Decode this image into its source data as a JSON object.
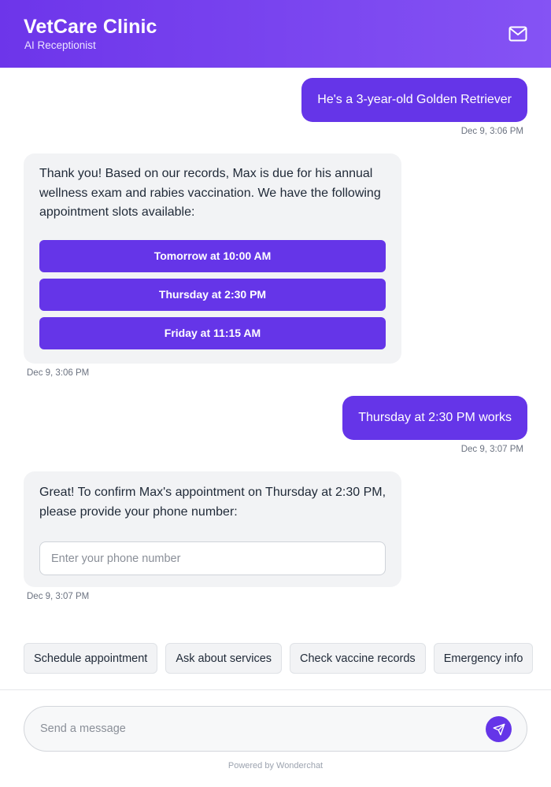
{
  "header": {
    "title": "VetCare Clinic",
    "subtitle": "AI Receptionist",
    "mail_icon": "mail-icon"
  },
  "messages": [
    {
      "from": "user",
      "text": "He's a 3-year-old Golden Retriever",
      "time": "Dec 9, 3:06 PM"
    },
    {
      "from": "bot",
      "text": "Thank you! Based on our records, Max is due for his annual wellness exam and rabies vaccination. We have the following appointment slots available:",
      "time": "Dec 9, 3:06 PM",
      "slots": [
        "Tomorrow at 10:00 AM",
        "Thursday at 2:30 PM",
        "Friday at 11:15 AM"
      ]
    },
    {
      "from": "user",
      "text": "Thursday at 2:30 PM works",
      "time": "Dec 9, 3:07 PM"
    },
    {
      "from": "bot",
      "text": "Great! To confirm Max's appointment on Thursday at 2:30 PM, please provide your phone number:",
      "time": "Dec 9, 3:07 PM",
      "input_placeholder": "Enter your phone number"
    }
  ],
  "quick_replies": [
    "Schedule appointment",
    "Ask about services",
    "Check vaccine records",
    "Emergency info"
  ],
  "composer": {
    "placeholder": "Send a message",
    "send_icon": "send-icon"
  },
  "footer": {
    "powered_by": "Powered by Wonderchat"
  },
  "colors": {
    "accent": "#6535e8",
    "header_gradient_start": "#6d35ea",
    "header_gradient_end": "#8553f4",
    "bot_bubble": "#f2f3f5"
  }
}
